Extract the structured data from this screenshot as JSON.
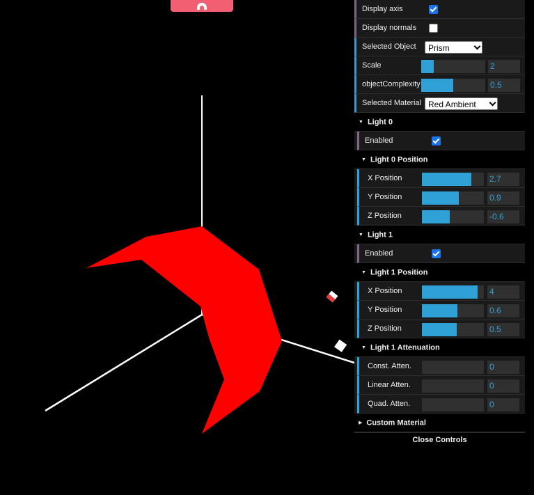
{
  "controls": {
    "display_axis": {
      "label": "Display axis",
      "checked": true
    },
    "display_normals": {
      "label": "Display normals",
      "checked": false
    },
    "selected_object": {
      "label": "Selected Object",
      "value": "Prism"
    },
    "scale": {
      "label": "Scale",
      "value": "2",
      "fraction": 0.2
    },
    "object_complexity": {
      "label": "objectComplexity",
      "value": "0.5",
      "fraction": 0.5
    },
    "selected_material": {
      "label": "Selected Material",
      "value": "Red Ambient"
    }
  },
  "light0": {
    "title": "Light 0",
    "enabled": {
      "label": "Enabled",
      "checked": true
    },
    "position_title": "Light 0 Position",
    "x": {
      "label": "X Position",
      "value": "2.7",
      "fraction": 0.8
    },
    "y": {
      "label": "Y Position",
      "value": "0.9",
      "fraction": 0.6
    },
    "z": {
      "label": "Z Position",
      "value": "-0.6",
      "fraction": 0.45
    }
  },
  "light1": {
    "title": "Light 1",
    "enabled": {
      "label": "Enabled",
      "checked": true
    },
    "position_title": "Light 1 Position",
    "x": {
      "label": "X Position",
      "value": "4",
      "fraction": 0.9
    },
    "y": {
      "label": "Y Position",
      "value": "0.6",
      "fraction": 0.57
    },
    "z": {
      "label": "Z Position",
      "value": "0.5",
      "fraction": 0.56
    },
    "attenuation_title": "Light 1 Attenuation",
    "const": {
      "label": "Const. Atten.",
      "value": "0",
      "fraction": 0
    },
    "linear": {
      "label": "Linear Atten.",
      "value": "0",
      "fraction": 0
    },
    "quad": {
      "label": "Quad. Atten.",
      "value": "0",
      "fraction": 0
    }
  },
  "custom_material_title": "Custom Material",
  "close_label": "Close Controls",
  "colors": {
    "accent": "#2fa1d6",
    "object": "#ff0000",
    "tab": "#f25f73"
  }
}
